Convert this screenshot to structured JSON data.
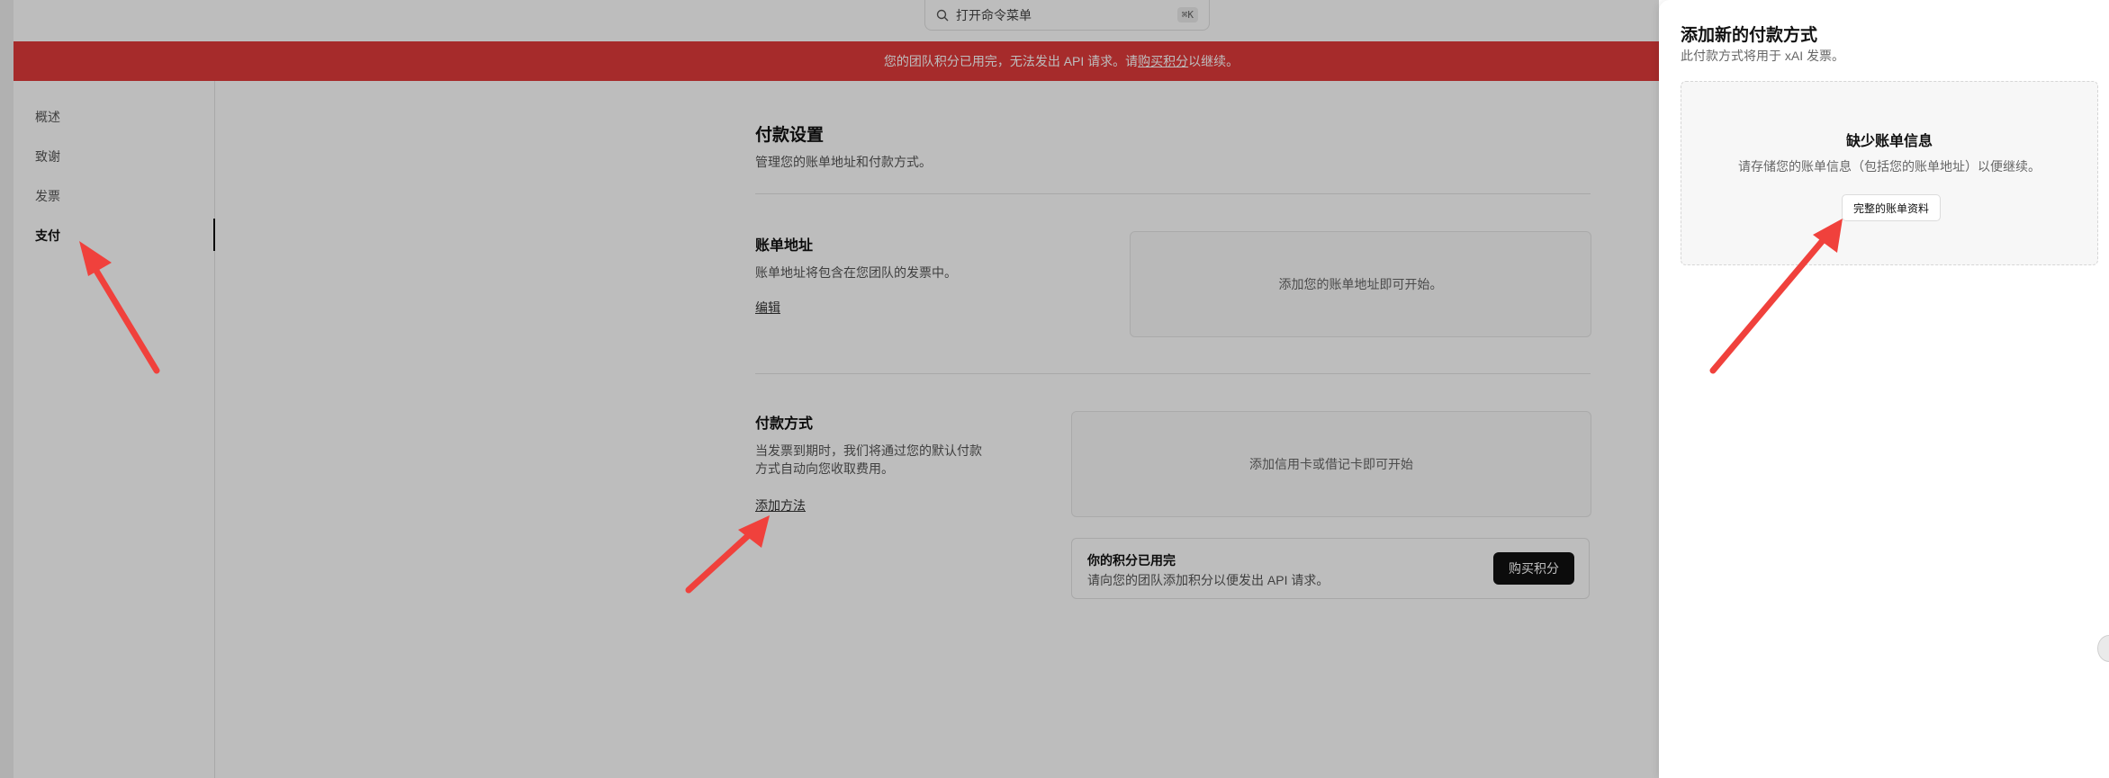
{
  "search": {
    "placeholder": "打开命令菜单",
    "shortcut": "⌘K",
    "icon": "search-icon"
  },
  "banner": {
    "text_before": "您的团队积分已用完，无法发出 API 请求。请",
    "link": "购买积分",
    "text_after": "以继续。",
    "color": "#e03a3a"
  },
  "sidebar": {
    "items": [
      {
        "label": "概述"
      },
      {
        "label": "致谢"
      },
      {
        "label": "发票"
      },
      {
        "label": "支付",
        "active": true
      }
    ]
  },
  "main": {
    "title": "付款设置",
    "subtitle": "管理您的账单地址和付款方式。",
    "billing_address": {
      "title": "账单地址",
      "description": "账单地址将包含在您团队的发票中。",
      "link": "编辑",
      "placeholder": "添加您的账单地址即可开始。"
    },
    "payment_method": {
      "title": "付款方式",
      "description_line1": "当发票到期时，我们将通过您的默认付款",
      "description_line2": "方式自动向您收取费用。",
      "link": "添加方法",
      "placeholder": "添加信用卡或借记卡即可开始"
    },
    "credits_card": {
      "title": "你的积分已用完",
      "description": "请向您的团队添加积分以便发出 API 请求。",
      "button": "购买积分"
    }
  },
  "drawer": {
    "title": "添加新的付款方式",
    "subtitle": "此付款方式将用于 xAI 发票。",
    "missing_title": "缺少账单信息",
    "missing_description": "请存储您的账单信息（包括您的账单地址）以便继续。",
    "button": "完整的账单资料"
  },
  "colors": {
    "annotation_arrow": "#f0413c",
    "accent_dark": "#111111"
  }
}
